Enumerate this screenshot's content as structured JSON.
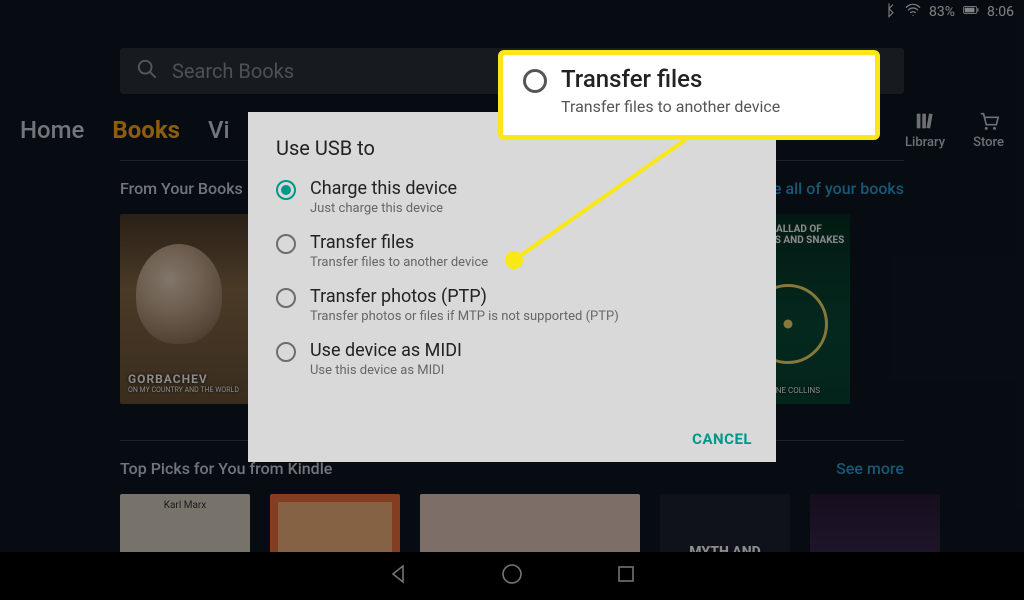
{
  "status": {
    "battery_pct": "83%",
    "time": "8:06"
  },
  "search": {
    "placeholder": "Search Books"
  },
  "tabs": {
    "home": "Home",
    "books": "Books",
    "videos_initial": "Vi",
    "library": "Library",
    "store": "Store"
  },
  "sections": {
    "from_your_books": {
      "title": "From Your Books",
      "link": "See all of your books"
    },
    "top_picks": {
      "title": "Top Picks for You from Kindle",
      "link": "See more"
    }
  },
  "books_row1": {
    "gorbachev_title": "GORBACHEV",
    "gorbachev_sub": "ON MY COUNTRY AND THE WORLD",
    "ballad_title": "THE BALLAD OF SONGBIRDS AND SNAKES",
    "ballad_author": "SUZANNE COLLINS"
  },
  "books_row2": {
    "marx": "Karl Marx",
    "myth": "MYTH AND"
  },
  "dialog": {
    "title": "Use USB to",
    "cancel": "CANCEL",
    "options": [
      {
        "label": "Charge this device",
        "sub": "Just charge this device",
        "selected": true
      },
      {
        "label": "Transfer files",
        "sub": "Transfer files to another device",
        "selected": false
      },
      {
        "label": "Transfer photos (PTP)",
        "sub": "Transfer photos or files if MTP is not supported (PTP)",
        "selected": false
      },
      {
        "label": "Use device as MIDI",
        "sub": "Use this device as MIDI",
        "selected": false
      }
    ]
  },
  "callout": {
    "label": "Transfer files",
    "sub": "Transfer files to another device"
  }
}
